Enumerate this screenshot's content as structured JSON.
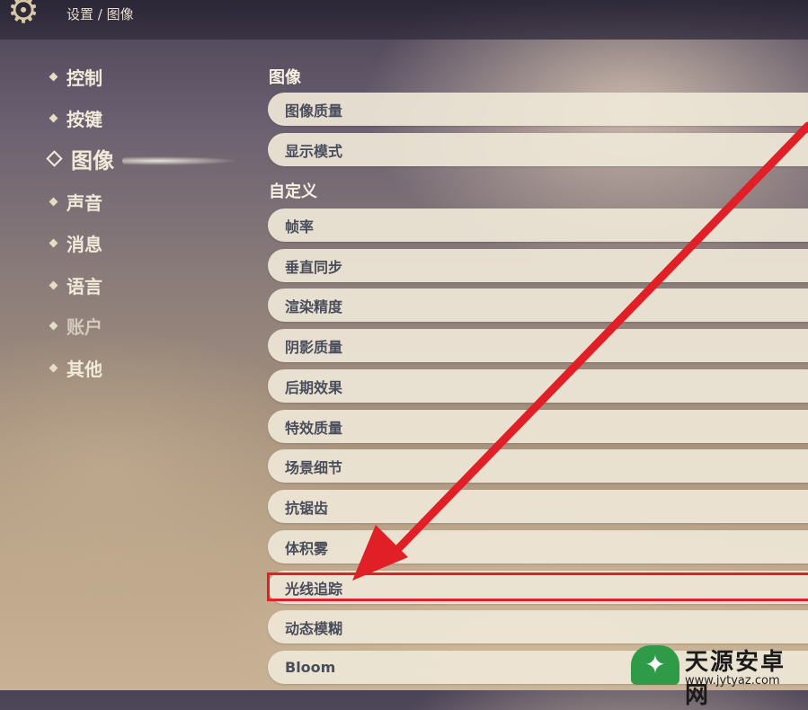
{
  "header": {
    "breadcrumb": "设置 / 图像"
  },
  "sidebar": {
    "items": [
      {
        "label": "控制"
      },
      {
        "label": "按键"
      },
      {
        "label": "图像",
        "active": true
      },
      {
        "label": "声音"
      },
      {
        "label": "消息"
      },
      {
        "label": "语言"
      },
      {
        "label": "账户",
        "dimmed": true
      },
      {
        "label": "其他"
      }
    ]
  },
  "main": {
    "sections": [
      {
        "title": "图像",
        "settings": [
          "图像质量",
          "显示模式"
        ]
      },
      {
        "title": "自定义",
        "settings": [
          "帧率",
          "垂直同步",
          "渲染精度",
          "阴影质量",
          "后期效果",
          "特效质量",
          "场景细节",
          "抗锯齿",
          "体积雾",
          "光线追踪",
          "动态模糊",
          "Bloom"
        ]
      }
    ],
    "highlighted_setting": "光线追踪"
  },
  "annotation": {
    "arrow_color": "#e11f26"
  },
  "watermark": {
    "title": "天源安卓网",
    "url": "www.jytyaz.com"
  }
}
